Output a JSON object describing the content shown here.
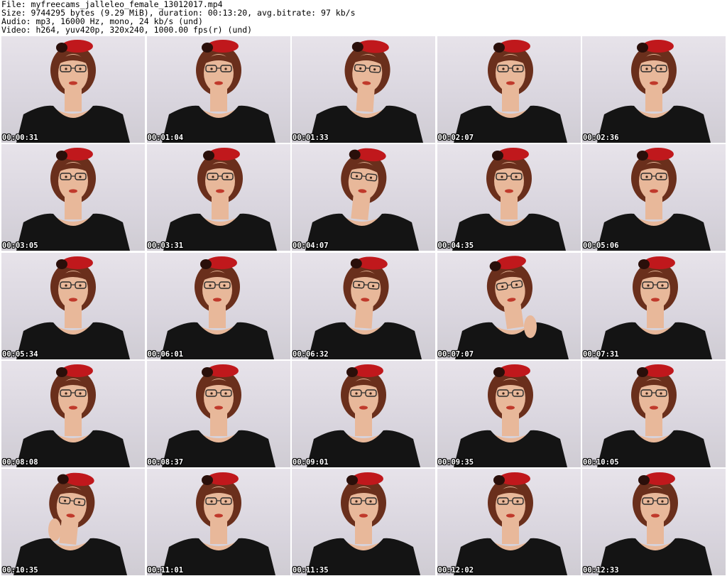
{
  "header": {
    "file_line": "File: myfreecams_jalleleo_female_13012017.mp4",
    "size_line": "Size: 9744295 bytes (9.29 MiB), duration: 00:13:20, avg.bitrate: 97 kb/s",
    "audio_line": "Audio: mp3, 16000 Hz, mono, 24 kb/s (und)",
    "video_line": "Video: h264, yuv420p, 320x240, 1000.00 fps(r) (und)"
  },
  "frames": [
    {
      "timestamp": "00:00:31"
    },
    {
      "timestamp": "00:01:04"
    },
    {
      "timestamp": "00:01:33"
    },
    {
      "timestamp": "00:02:07"
    },
    {
      "timestamp": "00:02:36"
    },
    {
      "timestamp": "00:03:05"
    },
    {
      "timestamp": "00:03:31"
    },
    {
      "timestamp": "00:04:07"
    },
    {
      "timestamp": "00:04:35"
    },
    {
      "timestamp": "00:05:06"
    },
    {
      "timestamp": "00:05:34"
    },
    {
      "timestamp": "00:06:01"
    },
    {
      "timestamp": "00:06:32"
    },
    {
      "timestamp": "00:07:07"
    },
    {
      "timestamp": "00:07:31"
    },
    {
      "timestamp": "00:08:08"
    },
    {
      "timestamp": "00:08:37"
    },
    {
      "timestamp": "00:09:01"
    },
    {
      "timestamp": "00:09:35"
    },
    {
      "timestamp": "00:10:05"
    },
    {
      "timestamp": "00:10:35"
    },
    {
      "timestamp": "00:11:01"
    },
    {
      "timestamp": "00:11:35"
    },
    {
      "timestamp": "00:12:02"
    },
    {
      "timestamp": "00:12:33"
    }
  ],
  "colors": {
    "background": "#d9d5de",
    "top": "#141414",
    "skin": "#e8b89a",
    "hair": "#6a2f1c",
    "flower": "#c0181c",
    "lips": "#c0392b"
  }
}
